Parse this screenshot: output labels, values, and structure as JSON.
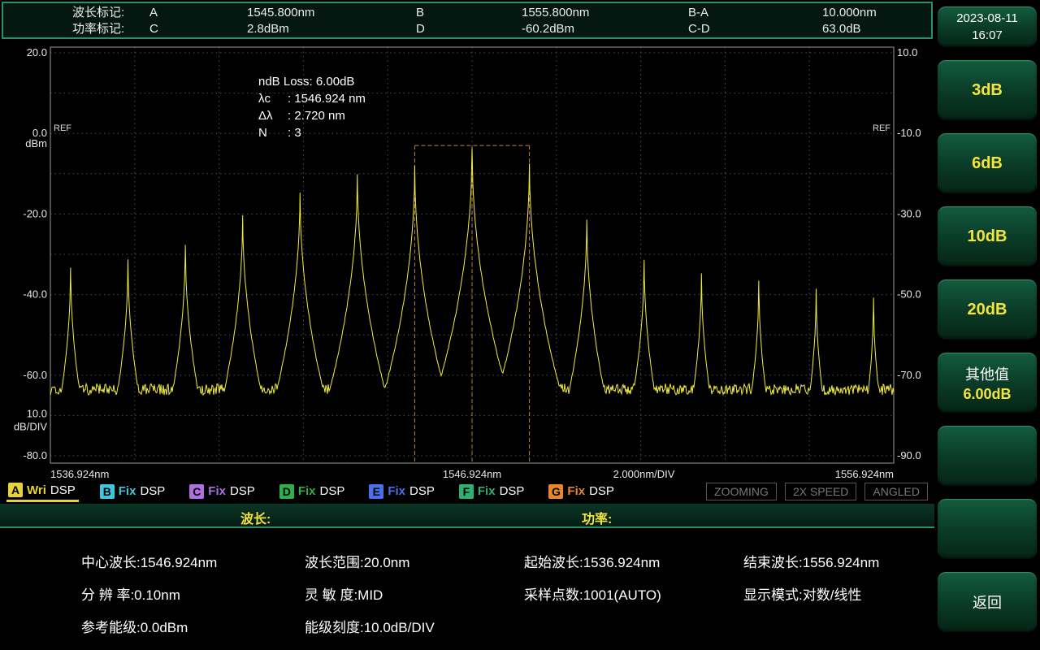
{
  "header": {
    "rows": [
      {
        "label": "波长标记:",
        "m1": "A",
        "v1": "1545.800nm",
        "m2": "B",
        "v2": "1555.800nm",
        "dm": "B-A",
        "dv": "10.000nm"
      },
      {
        "label": "功率标记:",
        "m1": "C",
        "v1": "2.8dBm",
        "m2": "D",
        "v2": "-60.2dBm",
        "dm": "C-D",
        "dv": "63.0dB"
      }
    ]
  },
  "sidebar": {
    "date": "2023-08-11",
    "time": "16:07",
    "buttons": [
      {
        "label": "3dB"
      },
      {
        "label": "6dB"
      },
      {
        "label": "10dB"
      },
      {
        "label": "20dB"
      }
    ],
    "other": {
      "label": "其他值",
      "value": "6.00dB"
    },
    "back": "返回"
  },
  "legend": {
    "traces": [
      {
        "letter": "A",
        "mode": "Wri",
        "suffix": "DSP",
        "color": "#e6d23c",
        "active": true
      },
      {
        "letter": "B",
        "mode": "Fix",
        "suffix": "DSP",
        "color": "#3ec6e0",
        "active": false
      },
      {
        "letter": "C",
        "mode": "Fix",
        "suffix": "DSP",
        "color": "#b06fe0",
        "active": false
      },
      {
        "letter": "D",
        "mode": "Fix",
        "suffix": "DSP",
        "color": "#2fae4a",
        "active": false
      },
      {
        "letter": "E",
        "mode": "Fix",
        "suffix": "DSP",
        "color": "#4b6fe8",
        "active": false
      },
      {
        "letter": "F",
        "mode": "Fix",
        "suffix": "DSP",
        "color": "#2fb070",
        "active": false
      },
      {
        "letter": "G",
        "mode": "Fix",
        "suffix": "DSP",
        "color": "#e8872a",
        "active": false
      }
    ],
    "status": [
      "ZOOMING",
      "2X SPEED",
      "ANGLED"
    ]
  },
  "bandlabels": {
    "wavelength": "波长:",
    "power": "功率:"
  },
  "info": {
    "rows": [
      [
        "中心波长:1546.924nm",
        "波长范围:20.0nm",
        "起始波长:1536.924nm",
        "结束波长:1556.924nm"
      ],
      [
        "分 辨 率:0.10nm",
        "灵 敏 度:MID",
        "采样点数:1001(AUTO)",
        "显示模式:对数/线性"
      ],
      [
        "参考能级:0.0dBm",
        "能级刻度:10.0dB/DIV"
      ]
    ]
  },
  "chart_data": {
    "type": "line",
    "x_range_nm": [
      1536.924,
      1556.924
    ],
    "y_range_dbm": [
      -80,
      20
    ],
    "db_per_div": 10,
    "nm_per_div": 2,
    "noise_floor_dbm": -63.5,
    "trace_color": "#f2ee3e",
    "marker_color": "#c08040",
    "grid_color": "#4f4f4f",
    "border_color": "#9a9a9a",
    "peaks": [
      {
        "nm": 1537.404,
        "dbm": -33.0
      },
      {
        "nm": 1538.764,
        "dbm": -31.0
      },
      {
        "nm": 1540.124,
        "dbm": -27.5
      },
      {
        "nm": 1541.484,
        "dbm": -20.0
      },
      {
        "nm": 1542.844,
        "dbm": -14.5
      },
      {
        "nm": 1544.204,
        "dbm": -10.0
      },
      {
        "nm": 1545.564,
        "dbm": -7.8
      },
      {
        "nm": 1546.924,
        "dbm": -3.5
      },
      {
        "nm": 1548.284,
        "dbm": -7.0
      },
      {
        "nm": 1549.644,
        "dbm": -21.0
      },
      {
        "nm": 1551.004,
        "dbm": -31.0
      },
      {
        "nm": 1552.364,
        "dbm": -34.5
      },
      {
        "nm": 1553.724,
        "dbm": -36.5
      },
      {
        "nm": 1555.084,
        "dbm": -38.5
      },
      {
        "nm": 1556.444,
        "dbm": -40.5
      }
    ],
    "ndb_marker": {
      "left_nm": 1545.564,
      "right_nm": 1548.284,
      "top_dbm": -3.0,
      "center_nm": 1546.924
    },
    "annotations": [
      {
        "label": "ndB Loss",
        "value": ": 6.00dB"
      },
      {
        "label": "λc",
        "value": ": 1546.924 nm"
      },
      {
        "label": "Δλ",
        "value": ": 2.720 nm"
      },
      {
        "label": "N",
        "value": ": 3"
      }
    ],
    "left_ticks": [
      {
        "dbm": 20,
        "label": "20.0"
      },
      {
        "dbm": 0,
        "label": "0.0"
      },
      {
        "dbm": -20,
        "label": "-20.0"
      },
      {
        "dbm": -40,
        "label": "-40.0"
      },
      {
        "dbm": -60,
        "label": "-60.0"
      },
      {
        "dbm": -80,
        "label": "-80.0"
      }
    ],
    "right_ticks": [
      {
        "dbm": 20,
        "label": "10.0"
      },
      {
        "dbm": 0,
        "label": "-10.0"
      },
      {
        "dbm": -20,
        "label": "-30.0"
      },
      {
        "dbm": -40,
        "label": "-50.0"
      },
      {
        "dbm": -60,
        "label": "-70.0"
      },
      {
        "dbm": -80,
        "label": "-90.0"
      }
    ],
    "unit_label": "dBm",
    "ref_label": "REF",
    "scale_label": [
      "10.0",
      "dB/DIV"
    ],
    "x_labels": [
      {
        "nm": 1536.924,
        "label": "1536.924nm",
        "anchor": "start"
      },
      {
        "nm": 1546.924,
        "label": "1546.924nm",
        "anchor": "middle"
      },
      {
        "nm": 1551.0,
        "label": "2.000nm/DIV",
        "anchor": "middle"
      },
      {
        "nm": 1556.924,
        "label": "1556.924nm",
        "anchor": "end"
      }
    ]
  }
}
